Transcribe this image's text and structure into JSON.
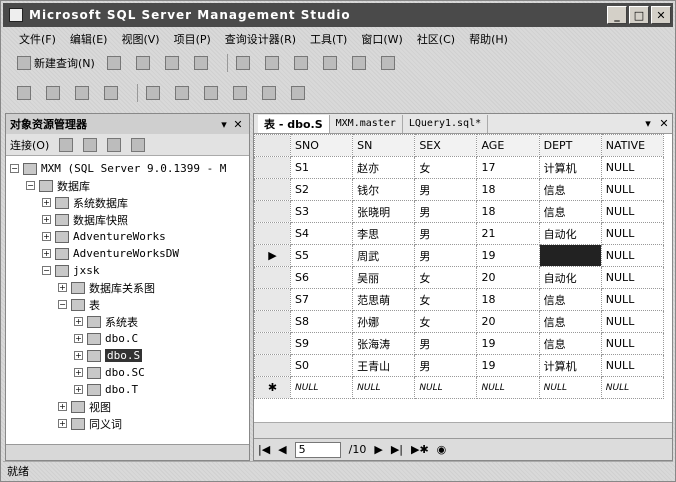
{
  "window": {
    "title": "Microsoft SQL Server Management Studio"
  },
  "menu": [
    "文件(F)",
    "编辑(E)",
    "视图(V)",
    "项目(P)",
    "查询设计器(R)",
    "工具(T)",
    "窗口(W)",
    "社区(C)",
    "帮助(H)"
  ],
  "toolbar": {
    "new_query": "新建查询(N)"
  },
  "object_explorer": {
    "title": "对象资源管理器",
    "connect": "连接(O)",
    "server": "MXM (SQL Server 9.0.1399 - M",
    "databases": "数据库",
    "system_databases": "系统数据库",
    "snapshots": "数据库快照",
    "db1": "AdventureWorks",
    "db2": "AdventureWorksDW",
    "db3": "jxsk",
    "diagrams": "数据库关系图",
    "tables": "表",
    "system_tables": "系统表",
    "t1": "dbo.C",
    "t2": "dbo.S",
    "t3": "dbo.SC",
    "t4": "dbo.T",
    "views": "视图",
    "synonyms": "同义词"
  },
  "tabs": {
    "active": "表 - dbo.S",
    "t2": "MXM.master",
    "t3": "LQuery1.sql*"
  },
  "grid": {
    "columns": [
      "SNO",
      "SN",
      "SEX",
      "AGE",
      "DEPT",
      "NATIVE"
    ],
    "rows": [
      [
        "S1",
        "赵亦",
        "女",
        "17",
        "计算机",
        "NULL"
      ],
      [
        "S2",
        "钱尔",
        "男",
        "18",
        "信息",
        "NULL"
      ],
      [
        "S3",
        "张晓明",
        "男",
        "18",
        "信息",
        "NULL"
      ],
      [
        "S4",
        "李思",
        "男",
        "21",
        "自动化",
        "NULL"
      ],
      [
        "S5",
        "周武",
        "男",
        "19",
        "",
        "NULL"
      ],
      [
        "S6",
        "吴丽",
        "女",
        "20",
        "自动化",
        "NULL"
      ],
      [
        "S7",
        "范思萌",
        "女",
        "18",
        "信息",
        "NULL"
      ],
      [
        "S8",
        "孙娜",
        "女",
        "20",
        "信息",
        "NULL"
      ],
      [
        "S9",
        "张海涛",
        "男",
        "19",
        "信息",
        "NULL"
      ],
      [
        "S0",
        "王青山",
        "男",
        "19",
        "计算机",
        "NULL"
      ]
    ],
    "new_row": [
      "NULL",
      "NULL",
      "NULL",
      "NULL",
      "NULL",
      "NULL"
    ]
  },
  "nav": {
    "current": "5",
    "total": "/10"
  },
  "status": "就绪"
}
